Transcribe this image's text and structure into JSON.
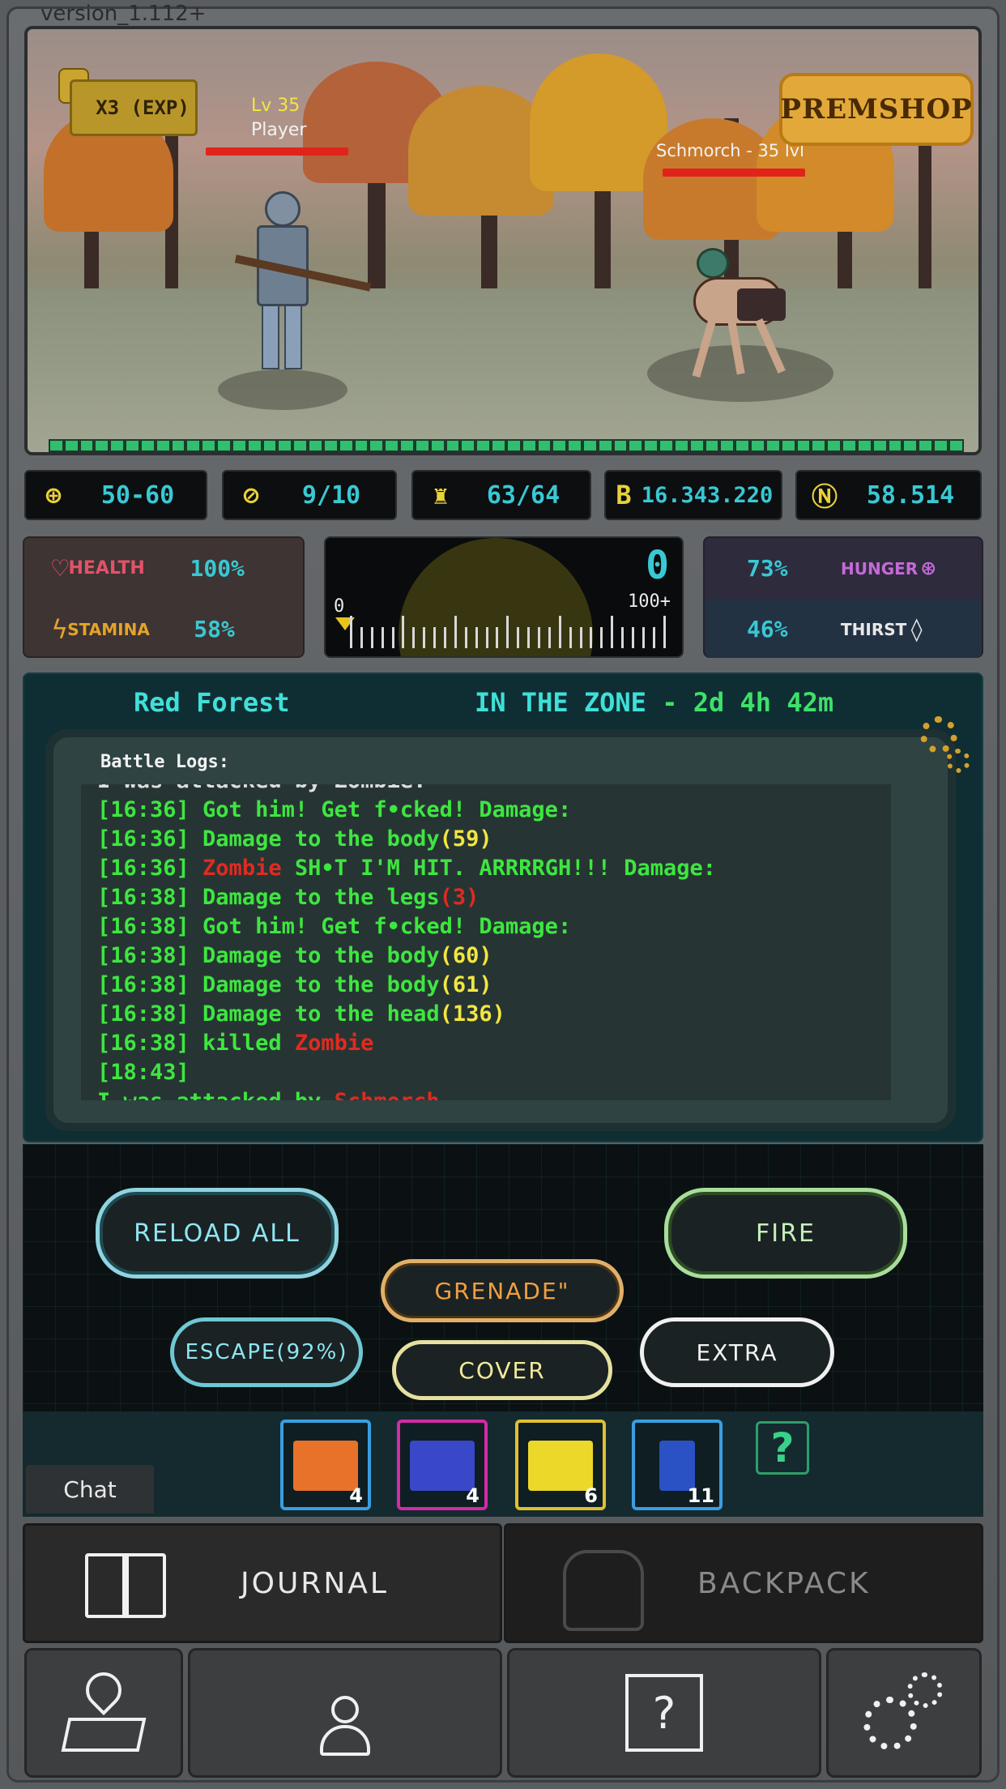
{
  "version": "version_1.112+",
  "scene": {
    "multiplier": "X3 (EXP)",
    "premshop_label": "PREMSHOP",
    "player_level": "Lv 35",
    "player_name": "Player",
    "enemy_label": "Schmorch - 35 lvl",
    "player_hp": 1.0,
    "enemy_hp": 1.0
  },
  "resources": [
    {
      "icon": "crosshair-icon",
      "value": "50-60"
    },
    {
      "icon": "weapon-icon",
      "value": "9/10"
    },
    {
      "icon": "weight-icon",
      "value": "63/64"
    },
    {
      "icon": "bitcoin-icon",
      "value": "16.343.220"
    },
    {
      "icon": "n-coin-icon",
      "value": "58.514"
    }
  ],
  "stats": {
    "health_label": "HEALTH",
    "health_value": "100%",
    "stamina_label": "STAMINA",
    "stamina_value": "58%",
    "hunger_value": "73%",
    "hunger_label": "HUNGER",
    "thirst_value": "46%",
    "thirst_label": "THIRST"
  },
  "radiation": {
    "value": "0",
    "min_label": "0",
    "max_label": "100+"
  },
  "zone": {
    "location": "Red Forest",
    "state": "IN THE ZONE",
    "separator": " - ",
    "time": "2d 4h 42m"
  },
  "log": {
    "title": "Battle Logs:",
    "cut_line": "I was attacked by Zombie.",
    "lines": [
      {
        "t": "[16:36] Got him! Get f•cked! Damage:",
        "hl": "",
        "hl_class": ""
      },
      {
        "t": "[16:36] Damage to the body",
        "hl": "(59)",
        "hl_class": "y"
      },
      {
        "t": "[16:36] ",
        "hl": "Zombie",
        "hl_class": "r",
        "tail": " SH•T I'M HIT. ARRRRGH!!! Damage:"
      },
      {
        "t": "[16:38] Damage to the legs",
        "hl": "(3)",
        "hl_class": "r"
      },
      {
        "t": "[16:38] Got him! Get f•cked! Damage:",
        "hl": "",
        "hl_class": ""
      },
      {
        "t": "[16:38] Damage to the body",
        "hl": "(60)",
        "hl_class": "y"
      },
      {
        "t": "[16:38] Damage to the body",
        "hl": "(61)",
        "hl_class": "y"
      },
      {
        "t": "[16:38] Damage to the head",
        "hl": "(136)",
        "hl_class": "y"
      },
      {
        "t": "[16:38] killed ",
        "hl": "Zombie",
        "hl_class": "r"
      },
      {
        "t": "[18:43]",
        "hl": "",
        "hl_class": ""
      },
      {
        "t": "I was attacked by ",
        "hl": "Schmorch",
        "hl_class": "r",
        "tail": "."
      }
    ]
  },
  "actions": {
    "reload": "RELOAD ALL",
    "fire": "FIRE",
    "grenade": "GRENADE\"",
    "escape": "ESCAPE(92%)",
    "cover": "COVER",
    "extra": "EXTRA"
  },
  "inventory": [
    {
      "icon": "orange-medkit-icon",
      "count": "4",
      "border": "#3a9ee0",
      "color": "#e8722a"
    },
    {
      "icon": "blue-medkit-icon",
      "count": "4",
      "border": "#d42aa6",
      "color": "#3848c8"
    },
    {
      "icon": "yellow-antirad-icon",
      "count": "6",
      "border": "#e0c030",
      "color": "#ecd828"
    },
    {
      "icon": "ammo-icon",
      "count": "11",
      "border": "#3a9ee0",
      "color": "#2a52c4"
    }
  ],
  "help_symbol": "?",
  "chat_label": "Chat",
  "nav": {
    "journal": "JOURNAL",
    "backpack": "BACKPACK"
  }
}
